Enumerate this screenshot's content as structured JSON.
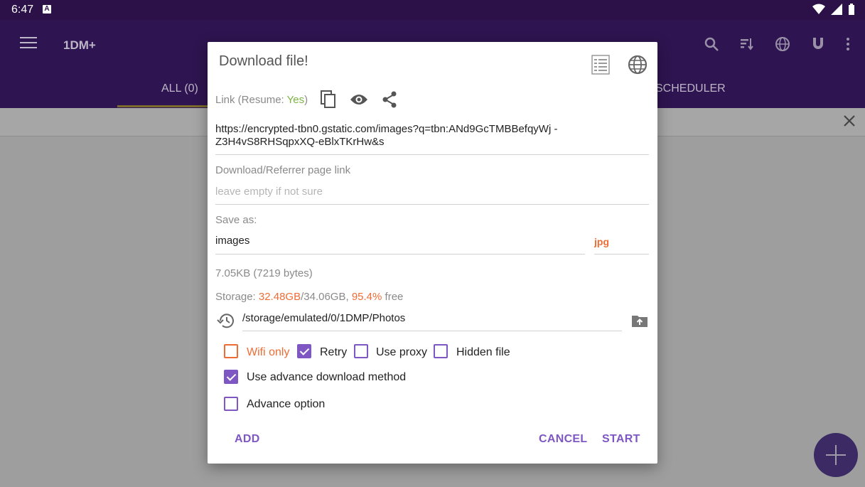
{
  "status_bar": {
    "time": "6:47",
    "notification_icon": "A"
  },
  "app": {
    "title": "1DM+",
    "tabs": {
      "all": "ALL (0)",
      "scheduler": "SCHEDULER"
    },
    "icons": [
      "menu-icon",
      "search-icon",
      "sort-icon",
      "globe-icon",
      "magnet-icon",
      "more-vert-icon"
    ]
  },
  "dialog": {
    "title": "Download file!",
    "link": {
      "prefix": "Link (Resume: ",
      "resume": "Yes",
      "suffix": ")",
      "url": "https://encrypted-tbn0.gstatic.com/images?q=tbn:ANd9GcTMBBefqyWj -Z3H4vS8RHSqpxXQ-eBlxTKrHw&s"
    },
    "referrer": {
      "label": "Download/Referrer page link",
      "placeholder": "leave empty if not sure"
    },
    "save_as": {
      "label": "Save as:",
      "filename": "images",
      "extension": "jpg"
    },
    "size": "7.05KB (7219 bytes)",
    "storage": {
      "prefix": "Storage: ",
      "free": "32.48GB",
      "sep": "/34.06GB, ",
      "percent": "95.4%",
      "suffix": " free"
    },
    "path": "/storage/emulated/0/1DMP/Photos",
    "options": {
      "wifi_only": {
        "label": "Wifi only",
        "checked": false
      },
      "retry": {
        "label": "Retry",
        "checked": true
      },
      "use_proxy": {
        "label": "Use proxy",
        "checked": false
      },
      "hidden_file": {
        "label": "Hidden file",
        "checked": false
      },
      "advance_method": {
        "label": "Use advance download method",
        "checked": true
      },
      "advance_option": {
        "label": "Advance option",
        "checked": false
      }
    },
    "buttons": {
      "add": "ADD",
      "cancel": "CANCEL",
      "start": "START"
    }
  },
  "colors": {
    "accent": "#7e57c2",
    "orange": "#ef6c35",
    "green": "#7cb342",
    "appbar": "#2e1450"
  }
}
